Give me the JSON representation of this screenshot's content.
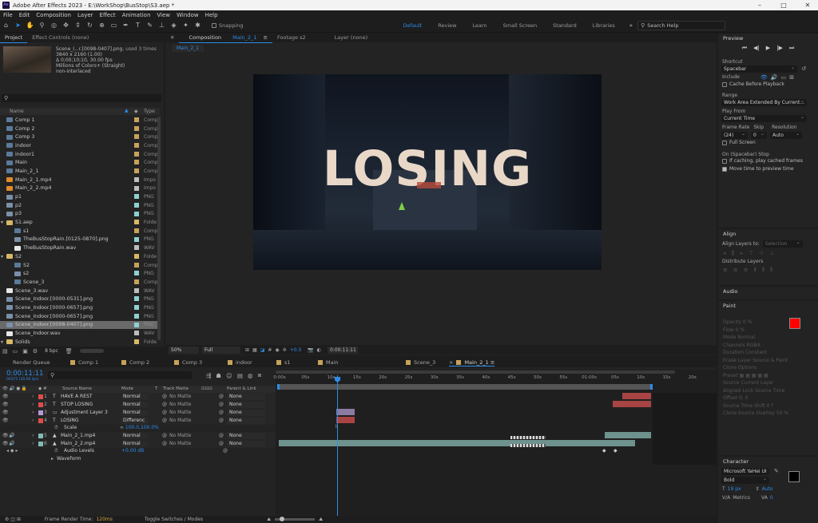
{
  "window": {
    "title": "Adobe After Effects 2023 - E:\\WorkShop\\BusStop\\S3.aep *",
    "logo": "Ae"
  },
  "menu": [
    "File",
    "Edit",
    "Composition",
    "Layer",
    "Effect",
    "Animation",
    "View",
    "Window",
    "Help"
  ],
  "toolbar": {
    "snapping": "Snapping",
    "workspaces": [
      "Default",
      "Learn",
      "Small Screen",
      "Standard",
      "Libraries"
    ],
    "review": "Review",
    "search_placeholder": "Search Help"
  },
  "project": {
    "tab": "Project",
    "tab2": "Effect Controls (none)",
    "preview_info": {
      "name": "Scene_I...r.[0098-0407].png",
      "used": ", used 3 times",
      "res": "3840 x 2160 (1.00)",
      "dur": "Δ 0;00;10;10, 30.00 fps",
      "colors": "Millions of Colors+ (Straight)",
      "interlace": "non-interlaced"
    },
    "col_name": "Name",
    "col_type": "Type",
    "items": [
      {
        "name": "Comp 1",
        "type": "Comp",
        "kind": "comp",
        "indent": 0
      },
      {
        "name": "Comp 2",
        "type": "Comp",
        "kind": "comp",
        "indent": 0
      },
      {
        "name": "Comp 3",
        "type": "Comp",
        "kind": "comp",
        "indent": 0
      },
      {
        "name": "indoor",
        "type": "Comp",
        "kind": "comp",
        "indent": 0
      },
      {
        "name": "indoor1",
        "type": "Comp",
        "kind": "comp",
        "indent": 0
      },
      {
        "name": "Main",
        "type": "Comp",
        "kind": "comp",
        "indent": 0
      },
      {
        "name": "Main_2_1",
        "type": "Comp",
        "kind": "comp",
        "indent": 0
      },
      {
        "name": "Main_2_1.mp4",
        "type": "Impo",
        "kind": "mp4",
        "indent": 0
      },
      {
        "name": "Main_2_2.mp4",
        "type": "Impo",
        "kind": "mp4",
        "indent": 0
      },
      {
        "name": "p1",
        "type": "PNG",
        "kind": "png",
        "indent": 0
      },
      {
        "name": "p2",
        "type": "PNG",
        "kind": "png",
        "indent": 0
      },
      {
        "name": "p3",
        "type": "PNG",
        "kind": "png",
        "indent": 0
      },
      {
        "name": "S1.aep",
        "type": "Folde",
        "kind": "folder",
        "indent": 0
      },
      {
        "name": "s1",
        "type": "Comp",
        "kind": "comp",
        "indent": 1
      },
      {
        "name": "TheBusStopRain.[0125-0870].png",
        "type": "PNG",
        "kind": "png",
        "indent": 1
      },
      {
        "name": "TheBusStopRain.wav",
        "type": "WAV",
        "kind": "wav",
        "indent": 1
      },
      {
        "name": "S2",
        "type": "Folde",
        "kind": "folder",
        "indent": 0
      },
      {
        "name": "S2",
        "type": "Comp",
        "kind": "comp",
        "indent": 1
      },
      {
        "name": "s2",
        "type": "PNG",
        "kind": "png",
        "indent": 1
      },
      {
        "name": "Scene_3",
        "type": "Comp",
        "kind": "comp",
        "indent": 1
      },
      {
        "name": "Scene_3.wav",
        "type": "WAV",
        "kind": "wav",
        "indent": 0
      },
      {
        "name": "Scene_Indoor.[0000-0531].png",
        "type": "PNG",
        "kind": "png",
        "indent": 0
      },
      {
        "name": "Scene_Indoor.[0000-0657].png",
        "type": "PNG",
        "kind": "png",
        "indent": 0
      },
      {
        "name": "Scene_Indoor.[0000-0657].png",
        "type": "PNG",
        "kind": "png",
        "indent": 0
      },
      {
        "name": "Scene_Indoor.[0098-0407].png",
        "type": "PNG",
        "kind": "png",
        "indent": 0,
        "selected": true
      },
      {
        "name": "Scene_Indoor.wav",
        "type": "WAV",
        "kind": "wav",
        "indent": 0
      },
      {
        "name": "Solids",
        "type": "Folde",
        "kind": "folder",
        "indent": 0
      }
    ],
    "bpc": "8 bpc"
  },
  "viewer": {
    "tab_comp": "Composition",
    "tab_comp_name": "Main_2_1",
    "tab_footage": "Footage s2",
    "tab_layer": "Layer (none)",
    "breadcrumb": "Main_2_1",
    "title_text": "LOSING",
    "zoom": "50%",
    "quality": "Full",
    "exposure": "+0.0",
    "timecode": "0:00:11:11"
  },
  "preview": {
    "title": "Preview",
    "shortcut_label": "Shortcut",
    "shortcut": "Spacebar",
    "include": "Include",
    "cache": "Cache Before Playback",
    "range_label": "Range",
    "range": "Work Area Extended By Current...",
    "play_from_label": "Play From",
    "play_from": "Current Time",
    "frame_rate_label": "Frame Rate",
    "skip_label": "Skip",
    "resolution_label": "Resolution",
    "frame_rate": "(24)",
    "skip": "0",
    "resolution": "Auto",
    "full_screen": "Full Screen",
    "stop_title": "On (Spacebar) Stop",
    "if_caching": "If caching, play cached frames",
    "move_time": "Move time to preview time"
  },
  "align": {
    "title": "Align",
    "align_to": "Align Layers to:",
    "selection": "Selection",
    "distribute": "Distribute Layers"
  },
  "audio": {
    "title": "Audio"
  },
  "paint": {
    "title": "Paint",
    "opacity": "Opacity",
    "opacity_val": "0 %",
    "flow": "Flow",
    "flow_val": "0 %",
    "mode": "Mode",
    "mode_val": "Normal",
    "channels": "Channels",
    "channels_val": "RGBA",
    "duration": "Duration",
    "duration_val": "Constant",
    "erase": "Erase",
    "erase_val": "Layer Source & Paint",
    "clone": "Clone Options",
    "preset": "Preset",
    "source": "Source",
    "source_val": "Current Layer",
    "aligned": "Aligned",
    "lock": "Lock Source Time",
    "offset": "Offset",
    "offset_val": "0, 0",
    "shift": "Source Time Shift",
    "shift_val": "0 f",
    "overlay": "Clone Source Overlay",
    "overlay_val": "50 %",
    "fg": "#ff0000"
  },
  "character": {
    "title": "Character",
    "font": "Microsoft YaHei UI",
    "style": "Bold",
    "size": "19 px",
    "leading": "Auto",
    "kerning": "Metrics",
    "tracking": "0"
  },
  "timeline": {
    "tabs": [
      "Render Queue",
      "Comp 1",
      "Comp 2",
      "Comp 3",
      "indoor",
      "s1",
      "Main",
      "Scene_3",
      "Main_2_1"
    ],
    "timecode": "0:00:11:11",
    "timecode_sub": "00371 (30.00 fps)",
    "col_source": "Source Name",
    "col_mode": "Mode",
    "col_t": "T",
    "col_matte": "Track Matte",
    "col_parent": "Parent & Link",
    "layers": [
      {
        "num": "1",
        "name": "HAVE A REST",
        "kind": "T",
        "mode": "Normal",
        "matte": "No Matte",
        "parent": "None",
        "color": "#e24b4b"
      },
      {
        "num": "2",
        "name": "STOP LOSING",
        "kind": "T",
        "mode": "Normal",
        "matte": "No Matte",
        "parent": "None",
        "color": "#e24b4b"
      },
      {
        "num": "3",
        "name": "Adjustment Layer 3",
        "kind": "A",
        "mode": "Normal",
        "matte": "No Matte",
        "parent": "None",
        "color": "#b59ad8"
      },
      {
        "num": "4",
        "name": "LOSING",
        "kind": "T",
        "mode": "Differenc",
        "matte": "No Matte",
        "parent": "None",
        "color": "#e24b4b"
      },
      {
        "num": "5",
        "name": "Main_2_1.mp4",
        "kind": "V",
        "mode": "Normal",
        "matte": "No Matte",
        "parent": "None",
        "color": "#7fbcb5"
      },
      {
        "num": "6",
        "name": "Main_2_2.mp4",
        "kind": "V",
        "mode": "Normal",
        "matte": "No Matte",
        "parent": "None",
        "color": "#7fbcb5"
      }
    ],
    "scale_label": "Scale",
    "scale_val": "100.0,100.0%",
    "audio_levels": "Audio Levels",
    "audio_val": "+0.00 dB",
    "waveform": "Waveform",
    "ruler": [
      "0:00s",
      "05s",
      "10s",
      "15s",
      "20s",
      "25s",
      "30s",
      "35s",
      "40s",
      "45s",
      "50s",
      "55s",
      "01:00s",
      "05s",
      "10s",
      "15s",
      "20s"
    ],
    "footer_render": "Frame Render Time:",
    "footer_render_val": "120ms",
    "footer_toggle": "Toggle Switches / Modes"
  }
}
